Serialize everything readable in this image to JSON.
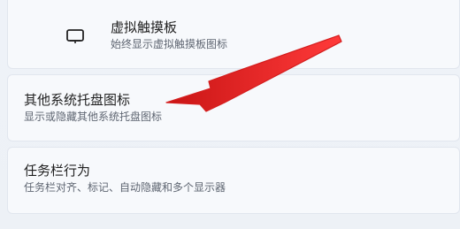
{
  "settings": {
    "touchpad": {
      "title": "虚拟触摸板",
      "description": "始终显示虚拟触摸板图标",
      "icon": "touchpad-icon"
    },
    "other_tray": {
      "title": "其他系统托盘图标",
      "description": "显示或隐藏其他系统托盘图标"
    },
    "taskbar_behavior": {
      "title": "任务栏行为",
      "description": "任务栏对齐、标记、自动隐藏和多个显示器"
    }
  },
  "annotation": {
    "arrow_color": "#e12323",
    "icon": "arrow-annotation"
  }
}
